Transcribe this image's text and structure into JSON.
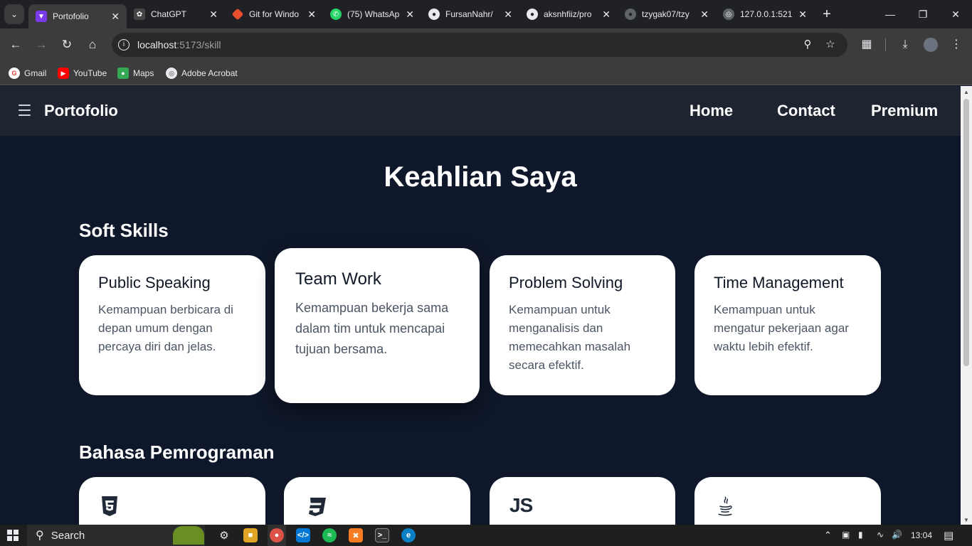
{
  "browser": {
    "tabs": [
      {
        "title": "Portofolio",
        "active": true
      },
      {
        "title": "ChatGPT",
        "active": false
      },
      {
        "title": "Git for Windo",
        "active": false
      },
      {
        "title": "(75) WhatsAp",
        "active": false
      },
      {
        "title": "FursanNahr/",
        "active": false
      },
      {
        "title": "aksnhfiiz/pro",
        "active": false
      },
      {
        "title": "tzygak07/tzy",
        "active": false
      },
      {
        "title": "127.0.0.1:521",
        "active": false
      }
    ],
    "url_host": "localhost",
    "url_path": ":5173/skill",
    "bookmarks": [
      "Gmail",
      "YouTube",
      "Maps",
      "Adobe Acrobat"
    ]
  },
  "page": {
    "brand": "Portofolio",
    "nav_links": [
      "Home",
      "Contact",
      "Premium"
    ],
    "title": "Keahlian Saya",
    "soft_skills": {
      "heading": "Soft Skills",
      "cards": [
        {
          "title": "Public Speaking",
          "desc": "Kemampuan berbicara di depan umum dengan percaya diri dan jelas."
        },
        {
          "title": "Team Work",
          "desc": "Kemampuan bekerja sama dalam tim untuk mencapai tujuan bersama."
        },
        {
          "title": "Problem Solving",
          "desc": "Kemampuan untuk menganalisis dan memecahkan masalah secara efektif."
        },
        {
          "title": "Time Management",
          "desc": "Kemampuan untuk mengatur pekerjaan agar waktu lebih efektif."
        }
      ]
    },
    "languages": {
      "heading": "Bahasa Pemrograman",
      "cards": [
        {
          "icon": "html5-icon"
        },
        {
          "icon": "css3-icon"
        },
        {
          "icon": "js-icon",
          "label": "JS"
        },
        {
          "icon": "java-icon"
        }
      ]
    }
  },
  "taskbar": {
    "search_label": "Search",
    "time": "13:04"
  }
}
